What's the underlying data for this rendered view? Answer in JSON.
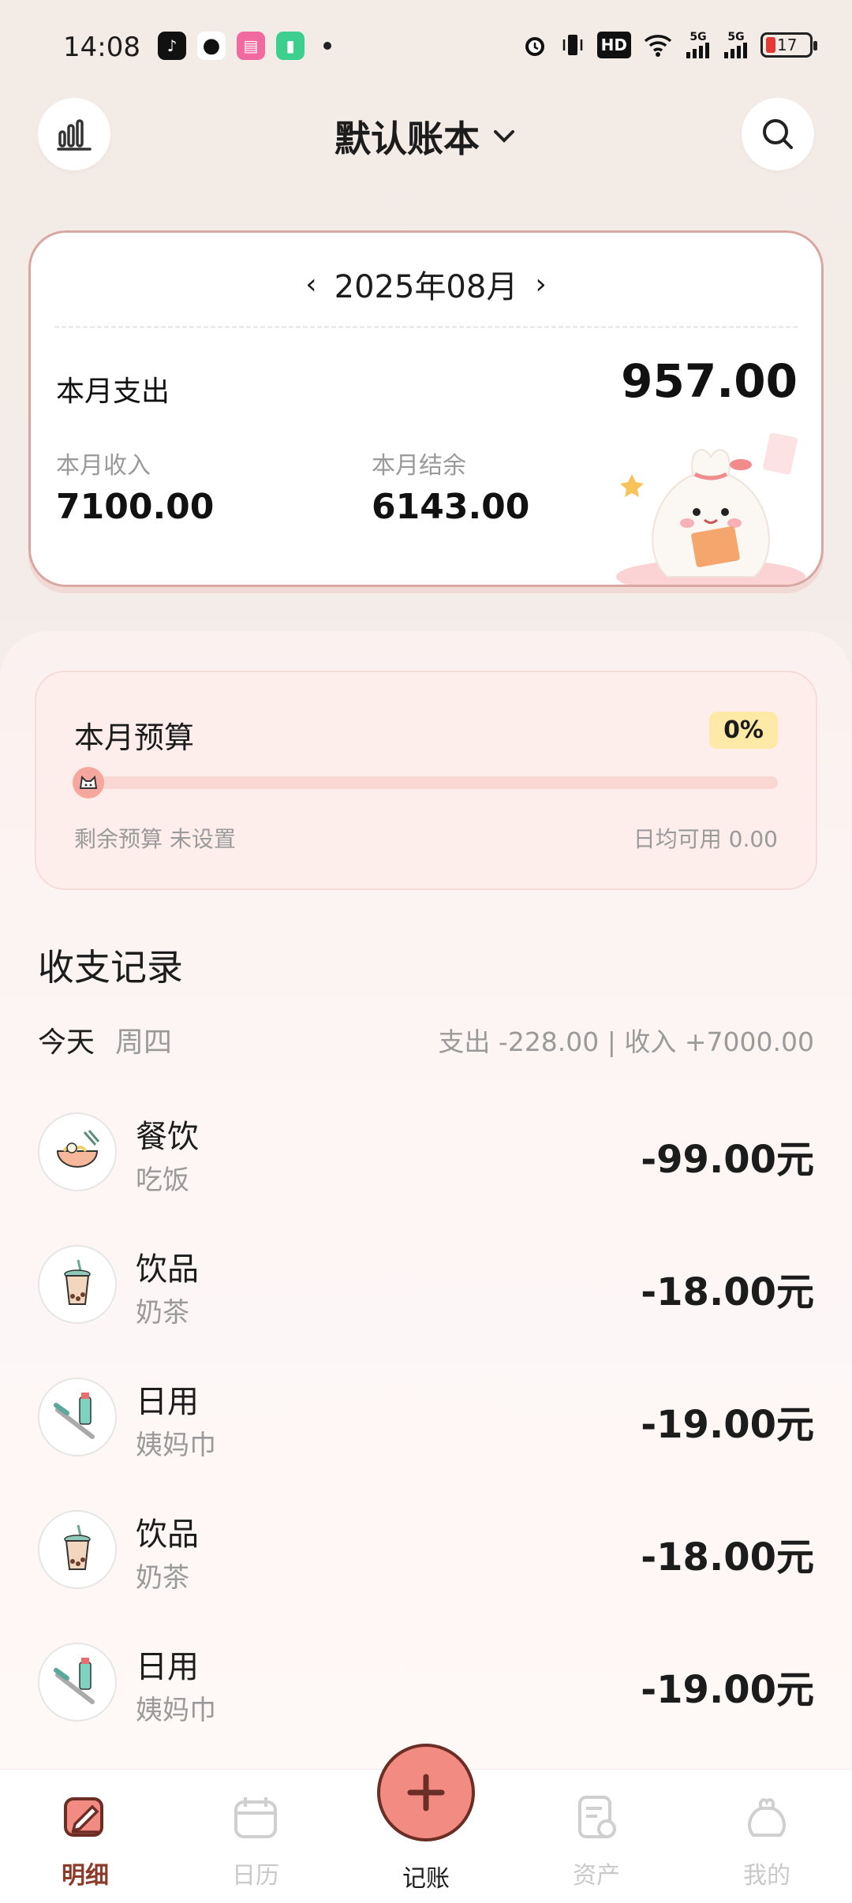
{
  "status_bar": {
    "time": "14:08",
    "battery": "17",
    "network_1": "5G",
    "network_2": "5G",
    "hd": "HD"
  },
  "header": {
    "title": "默认账本",
    "stats_icon": "bar-chart-icon",
    "search_icon": "search-icon"
  },
  "summary": {
    "month": "2025年08月",
    "expense_label": "本月支出",
    "expense_value": "957.00",
    "income_label": "本月收入",
    "income_value": "7100.00",
    "balance_label": "本月结余",
    "balance_value": "6143.00"
  },
  "budget": {
    "title": "本月预算",
    "percent": "0%",
    "progress": 0,
    "remaining": "剩余预算 未设置",
    "daily": "日均可用 0.00"
  },
  "records": {
    "title": "收支记录",
    "day": "今天",
    "weekday": "周四",
    "day_summary": "支出 -228.00 | 收入 +7000.00",
    "items": [
      {
        "category": "餐饮",
        "note": "吃饭",
        "amount": "-99.00元",
        "icon": "noodle-bowl-icon"
      },
      {
        "category": "饮品",
        "note": "奶茶",
        "amount": "-18.00元",
        "icon": "bubble-tea-icon"
      },
      {
        "category": "日用",
        "note": "姨妈巾",
        "amount": "-19.00元",
        "icon": "toothbrush-icon"
      },
      {
        "category": "饮品",
        "note": "奶茶",
        "amount": "-18.00元",
        "icon": "bubble-tea-icon"
      },
      {
        "category": "日用",
        "note": "姨妈巾",
        "amount": "-19.00元",
        "icon": "toothbrush-icon"
      }
    ]
  },
  "nav": {
    "details": "明细",
    "calendar": "日历",
    "add": "记账",
    "assets": "资产",
    "me": "我的"
  },
  "colors": {
    "accent": "#f28b82",
    "active_nav": "#8b3b2a",
    "card_border": "#d9a7a2"
  }
}
